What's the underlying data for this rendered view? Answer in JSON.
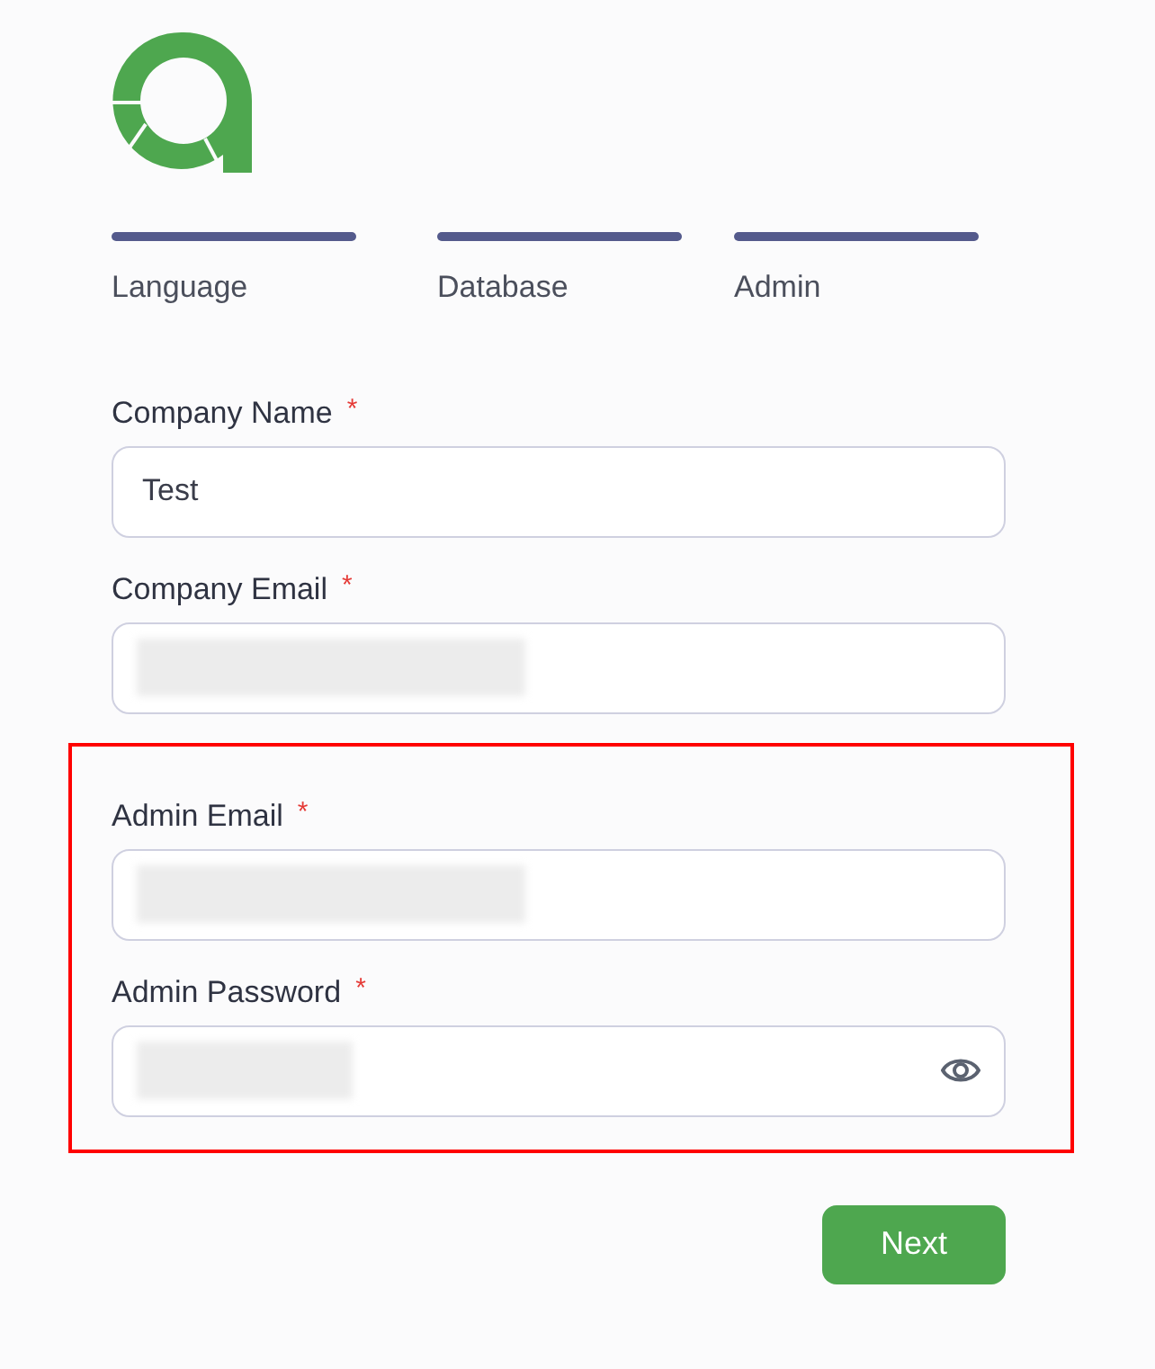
{
  "steps": [
    {
      "label": "Language",
      "completed": true
    },
    {
      "label": "Database",
      "completed": true
    },
    {
      "label": "Admin",
      "completed": true
    }
  ],
  "fields": [
    {
      "label": "Company Name",
      "required_mark": "*",
      "kind": "text",
      "value": "Test",
      "redacted": false,
      "highlighted": false
    },
    {
      "label": "Company Email",
      "required_mark": "*",
      "kind": "text",
      "redacted": true,
      "highlighted": false
    },
    {
      "label": "Admin Email",
      "required_mark": "*",
      "kind": "text",
      "redacted": true,
      "highlighted": true
    },
    {
      "label": "Admin Password",
      "required_mark": "*",
      "kind": "password",
      "redacted": true,
      "highlighted": true
    }
  ],
  "next_button": {
    "label": "Next"
  }
}
